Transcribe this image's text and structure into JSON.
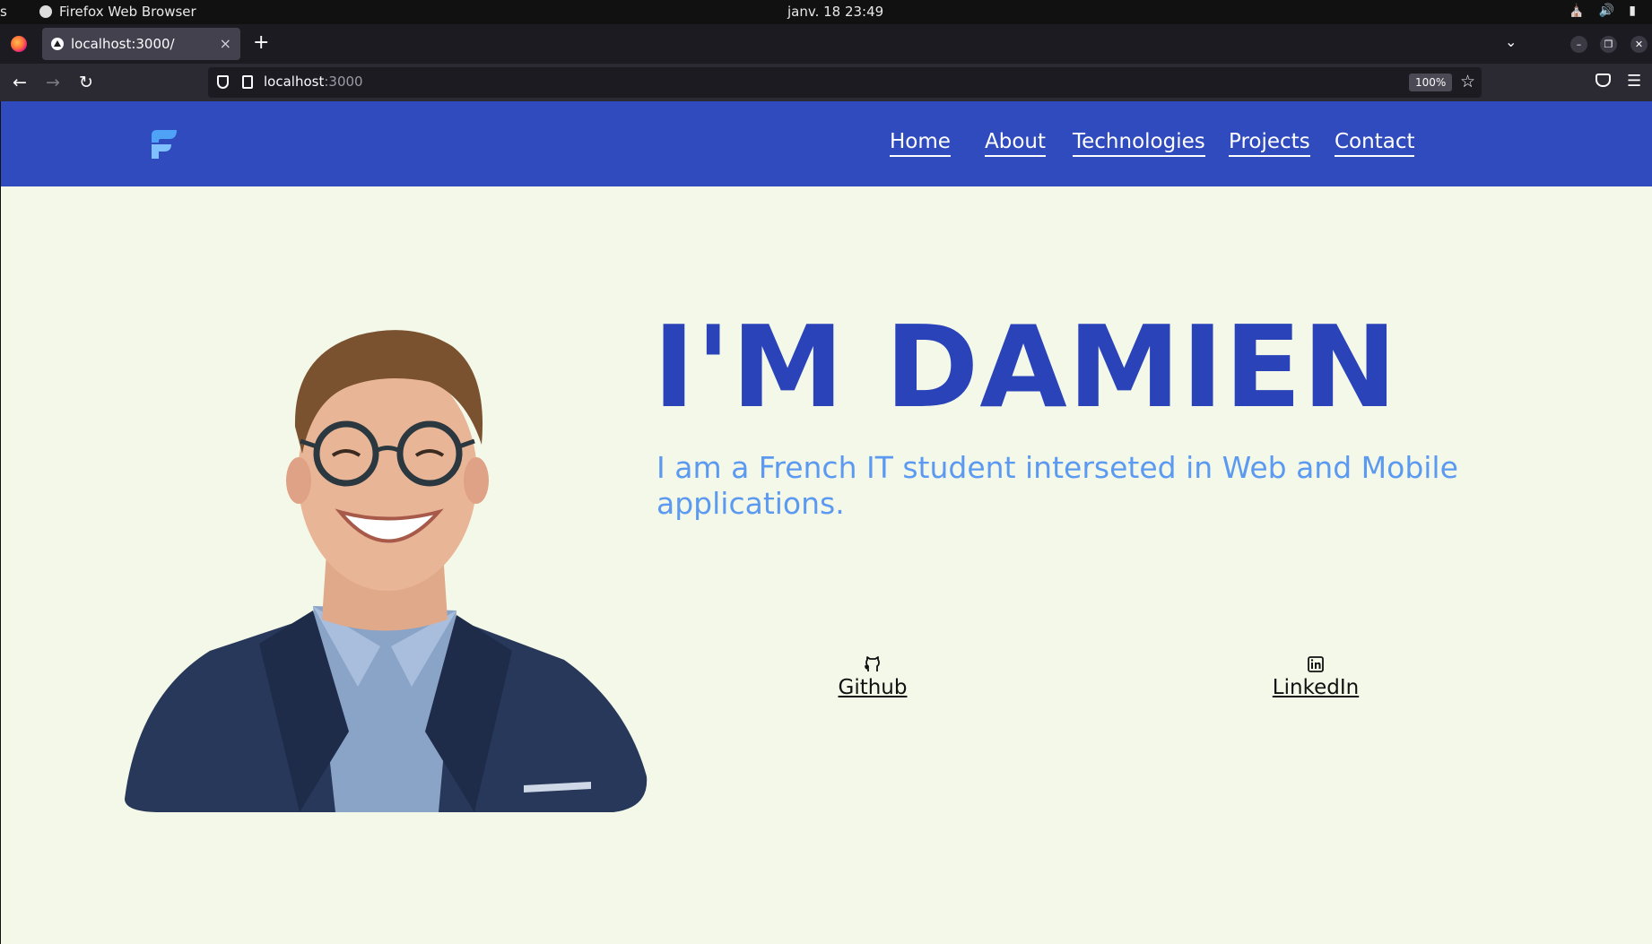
{
  "os": {
    "left_text": "s",
    "app_name": "Firefox Web Browser",
    "clock": "janv. 18  23:49"
  },
  "browser": {
    "tab_title": "localhost:3000/",
    "tab_close": "×",
    "new_tab": "+",
    "url_host": "localhost",
    "url_port": ":3000",
    "zoom": "100%"
  },
  "site": {
    "colors": {
      "header": "#2f4bbd",
      "background": "#f4f8e8",
      "title": "#2a43b9",
      "subtitle": "#5b9af0"
    },
    "nav": [
      "Home",
      "About",
      "Technologies",
      "Projects",
      "Contact"
    ],
    "hero_title": "I'M DAMIEN",
    "hero_subtitle": "I am a French IT student interseted in Web and Mobile applications.",
    "links": [
      {
        "label": "Github",
        "icon": "github-icon"
      },
      {
        "label": "LinkedIn",
        "icon": "linkedin-icon"
      }
    ]
  }
}
